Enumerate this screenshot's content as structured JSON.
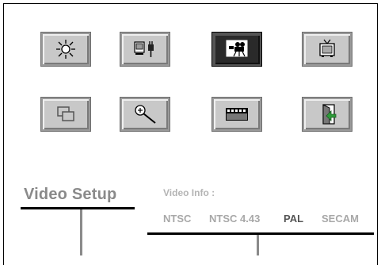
{
  "panel": {
    "buttons": [
      {
        "icon": "brightness-icon",
        "active": false
      },
      {
        "icon": "device-plug-icon",
        "active": false
      },
      {
        "icon": "video-camera-icon",
        "active": true
      },
      {
        "icon": "tv-icon",
        "active": false
      },
      {
        "icon": "windows-icon",
        "active": false
      },
      {
        "icon": "zoom-icon",
        "active": false
      },
      {
        "icon": "film-strip-icon",
        "active": false
      },
      {
        "icon": "door-exit-icon",
        "active": false
      }
    ]
  },
  "video_setup": {
    "title": "Video Setup",
    "info_label": "Video Info :",
    "standards": [
      {
        "label": "NTSC",
        "selected": false
      },
      {
        "label": "NTSC 4.43",
        "selected": false
      },
      {
        "label": "PAL",
        "selected": true
      },
      {
        "label": "SECAM",
        "selected": false
      }
    ]
  },
  "colors": {
    "button_face": "#c8c8c8",
    "button_active": "#2a2a2a",
    "label_gray": "#8a8a8a",
    "selected_text": "#555555"
  }
}
